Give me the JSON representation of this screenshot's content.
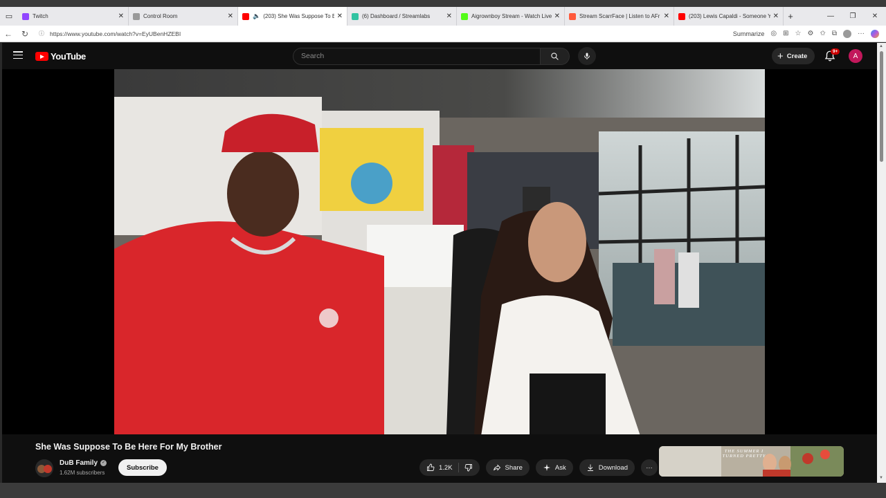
{
  "browser": {
    "tabs": [
      {
        "title": "Twitch",
        "favicon_color": "#9146ff",
        "active": false
      },
      {
        "title": "Control Room",
        "favicon_color": "#7a7a7a",
        "active": false
      },
      {
        "title": "(203) She Was Suppose To B",
        "favicon_color": "#ff0000",
        "active": true
      },
      {
        "title": "(6) Dashboard / Streamlabs",
        "favicon_color": "#31c3a2",
        "active": false
      },
      {
        "title": "Aigrownboy Stream - Watch Live",
        "favicon_color": "#53fc18",
        "active": false
      },
      {
        "title": "Stream ScarrFace | Listen to AFr",
        "favicon_color": "#ff5a3c",
        "active": false
      },
      {
        "title": "(203) Lewis Capaldi - Someone Y",
        "favicon_color": "#ff0000",
        "active": false
      }
    ],
    "url": "https://www.youtube.com/watch?v=EyUBenHZEBI",
    "summarize_label": "Summarize",
    "window_controls": [
      "—",
      "❐",
      "✕"
    ]
  },
  "youtube": {
    "logo_text": "YouTube",
    "search_placeholder": "Search",
    "create_label": "Create",
    "notification_badge": "9+",
    "avatar_letter": "A",
    "colors": {
      "brand_red": "#ff0000",
      "avatar_bg": "#c2185b",
      "bg": "#0f0f0f"
    }
  },
  "video": {
    "title": "She Was Suppose To Be Here For My Brother",
    "channel_name": "DuB Family",
    "subscribers": "1.62M subscribers",
    "subscribe_label": "Subscribe",
    "likes": "1.2K",
    "share_label": "Share",
    "ask_label": "Ask",
    "download_label": "Download",
    "more_label": "···"
  },
  "recommended": {
    "thumbnail_text": "THE SUMMER I TURNED PRETTY"
  }
}
